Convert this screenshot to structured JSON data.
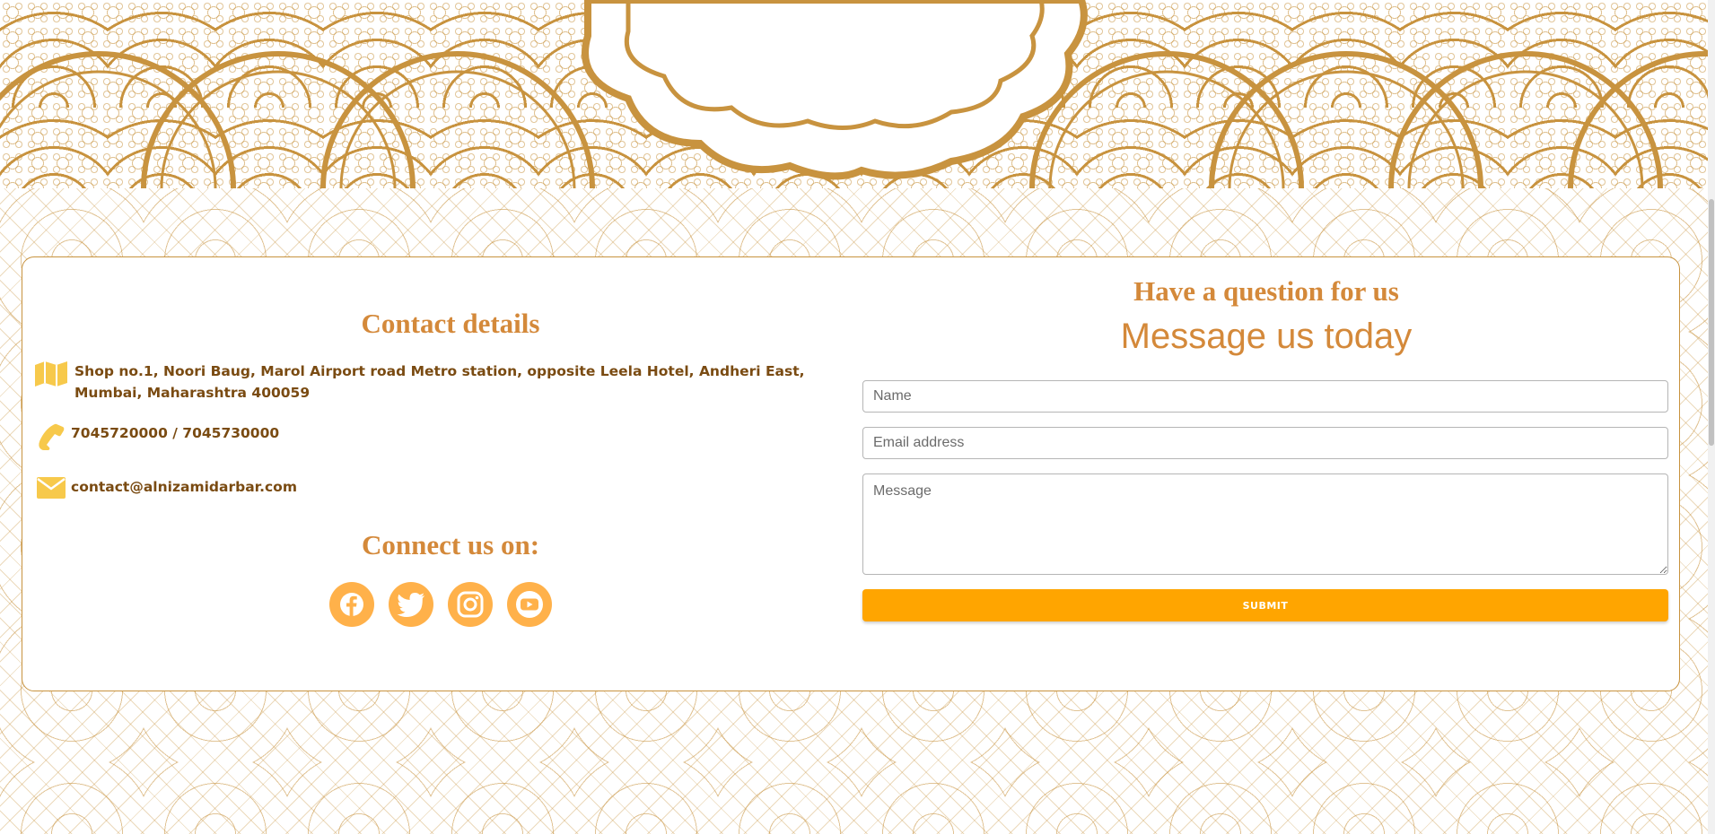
{
  "contact": {
    "heading": "Contact details",
    "address": "Shop no.1, Noori Baug, Marol Airport road Metro station, opposite Leela Hotel, Andheri East, Mumbai, Maharashtra 400059",
    "phone": "7045720000 / 7045730000",
    "email": "contact@alnizamidarbar.com",
    "icons": [
      "map-icon",
      "phone-icon",
      "envelope-icon"
    ]
  },
  "connect": {
    "heading": "Connect us on:",
    "socials": [
      "facebook-icon",
      "twitter-icon",
      "instagram-icon",
      "youtube-icon"
    ]
  },
  "form": {
    "pre_heading": "Have a question for us",
    "heading": "Message us today",
    "name_placeholder": "Name",
    "email_placeholder": "Email address",
    "message_placeholder": "Message",
    "submit_label": "Submit"
  },
  "colors": {
    "accent": "#d4893a",
    "gold_line": "#c8933f",
    "icon_yellow": "#f7c94b",
    "social_bg": "#ffb14a",
    "submit_bg": "#ffa500",
    "text_brown": "#7a4b12"
  }
}
